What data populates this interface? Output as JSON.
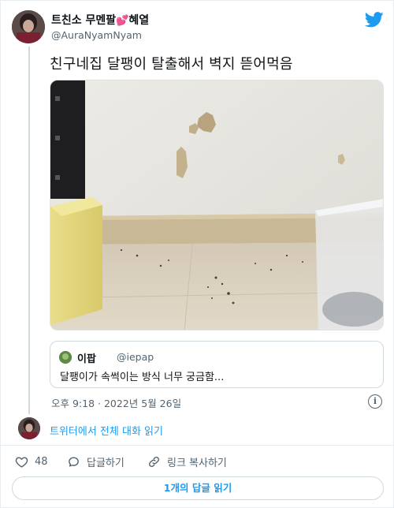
{
  "tweet": {
    "display_name": "트친소 무멘팔",
    "display_name_suffix": "혜열",
    "handle": "@AuraNyamNyam",
    "text": "친구네집 달팽이 탈출해서 벽지 뜯어먹음",
    "timestamp": "오후 9:18 · 2022년 5월 26일",
    "info_icon_glyph": "i"
  },
  "quote": {
    "name": "이팝",
    "handle": "@iepap",
    "text": "달팽이가 속썩이는 방식 너무 궁금함..."
  },
  "conversation": {
    "read_label": "트위터에서 전체 대화 읽기"
  },
  "actions": {
    "like_count": "48",
    "reply_label": "답글하기",
    "share_label": "링크 복사하기"
  },
  "replies": {
    "button_label": "1개의 답글 읽기"
  },
  "colors": {
    "accent": "#1d9bf0",
    "heart": "#e0245e",
    "secondary_text": "#536471"
  },
  "icons": {
    "brand": "twitter-bird-icon",
    "like": "heart-outline-icon",
    "reply": "speech-bubble-icon",
    "share": "link-icon",
    "info": "info-circle-icon"
  }
}
